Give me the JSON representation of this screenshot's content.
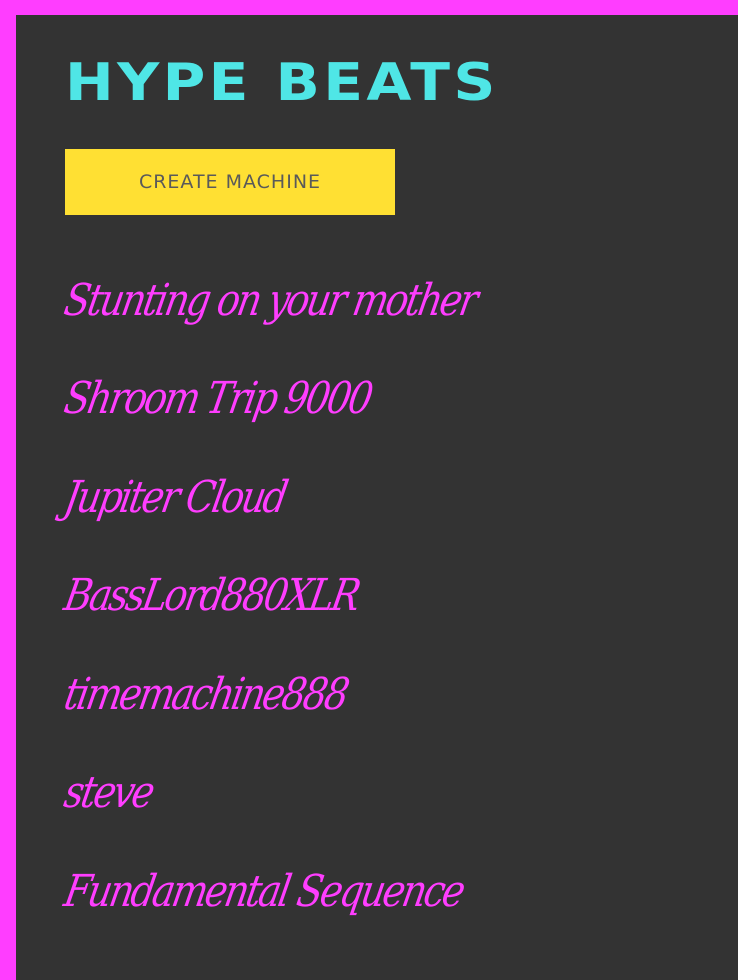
{
  "header": {
    "title": "HYPE BEATS"
  },
  "actions": {
    "create_label": "CREATE MACHINE"
  },
  "machines": [
    "Stunting on your mother",
    "Shroom Trip 9000",
    "Jupiter Cloud",
    "BassLord880XLR",
    "timemachine888",
    "steve",
    "Fundamental Sequence"
  ],
  "colors": {
    "border": "#ff3dff",
    "background": "#333333",
    "title": "#4fe6e6",
    "button": "#ffe033",
    "button_text": "#5a5a5a",
    "list_text": "#ff3dff"
  }
}
